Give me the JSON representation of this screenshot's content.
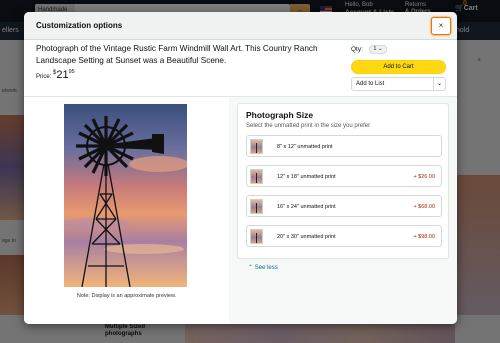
{
  "background": {
    "search_category": "Handmade",
    "greeting": "Hello, Bob",
    "account_label": "Account & Lists",
    "returns_line1": "Returns",
    "returns_line2": "& Orders",
    "cart_label": "Cart",
    "cart_count": "0",
    "nav_left": "ellers",
    "nav_right": "hold",
    "breadcrumb_left": "etwork",
    "breadcrumb_right": "s",
    "side_label": "age to",
    "bottom_heading": "Multiple Sized photographs"
  },
  "modal": {
    "title": "Customization options",
    "close_label": "×",
    "product_title": "Photograph of the Vintage Rustic Farm Windmill Wall Art. This Country Ranch Landscape Setting at Sunset was a Beautiful Scene.",
    "price_label": "Price:",
    "price_currency": "$",
    "price_whole": "21",
    "price_fraction": "95",
    "qty_label": "Qty:",
    "qty_value": "1",
    "add_to_cart": "Add to Cart",
    "add_to_list": "Add to List",
    "preview_note": "Note: Display is an approximate preview."
  },
  "options": {
    "title": "Photograph Size",
    "subtitle": "Select the unmatted print in the size you prefer",
    "sizes": [
      {
        "label": "8\" x 12\" unmatted print",
        "price": ""
      },
      {
        "label": "12\" x 18\" unmatted print",
        "price": "+ $26.00"
      },
      {
        "label": "16\" x 24\" unmatted print",
        "price": "+ $68.00"
      },
      {
        "label": "20\" x 30\" unmatted print",
        "price": "+ $98.00"
      }
    ],
    "see_less": "See less"
  },
  "colors": {
    "add_to_cart": "#ffd814",
    "close_focus": "#e77600",
    "price_red": "#b12704",
    "link": "#007185"
  }
}
